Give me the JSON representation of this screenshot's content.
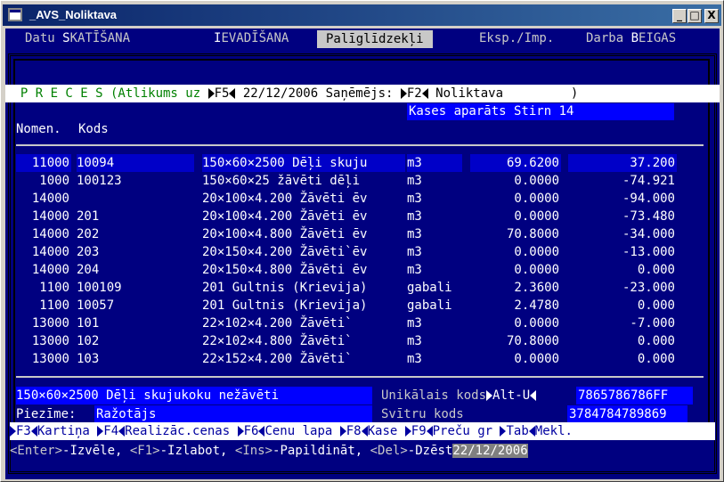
{
  "window": {
    "title": "_AVS_Noliktava",
    "min": "_",
    "max": "□",
    "close": "X"
  },
  "menu": [
    {
      "pre": "Datu ",
      "hot": "S",
      "post": "KATĪŠANA"
    },
    {
      "pre": "",
      "hot": "I",
      "post": "EVADĪŠANA"
    },
    {
      "pre": "Palīglīdzekļi",
      "hot": "",
      "post": ""
    },
    {
      "pre": "Eksp./Imp.",
      "hot": "",
      "post": ""
    },
    {
      "pre": "Darba ",
      "hot": "B",
      "post": "EIGAS"
    }
  ],
  "header": {
    "prefix": "  P R E C E S (Atlikums uz ",
    "f5": "F5",
    "date": " 22/12/2006 Saņēmējs: ",
    "f2": "F2",
    "warehouse": " Noliktava         )"
  },
  "kases": "Kases aparāts Stirn 14",
  "columns": {
    "nomen": "Nomen.",
    "kods": "Kods"
  },
  "rows": [
    {
      "nomen": "11000",
      "kods": "10094",
      "name": "150×60×2500 Dēļi skuju",
      "unit": "m3",
      "qty": "69.6200",
      "price": "37.200"
    },
    {
      "nomen": "1000",
      "kods": "100123",
      "name": "150×60×25 žāvēti dēļi",
      "unit": "m3",
      "qty": "0.0000",
      "price": "-74.921"
    },
    {
      "nomen": "14000",
      "kods": "",
      "name": "20×100×4.200 Žāvēti ēv",
      "unit": "m3",
      "qty": "0.0000",
      "price": "-94.000"
    },
    {
      "nomen": "14000",
      "kods": "201",
      "name": "20×100×4.200 Žāvēti ēv",
      "unit": "m3",
      "qty": "0.0000",
      "price": "-73.480"
    },
    {
      "nomen": "14000",
      "kods": "202",
      "name": "20×100×4.800 Žāvēti ēv",
      "unit": "m3",
      "qty": "70.8000",
      "price": "-34.000"
    },
    {
      "nomen": "14000",
      "kods": "203",
      "name": "20×150×4.200 Žāvēti`ēv",
      "unit": "m3",
      "qty": "0.0000",
      "price": "-13.000"
    },
    {
      "nomen": "14000",
      "kods": "204",
      "name": "20×150×4.800 Žāvēti ēv",
      "unit": "m3",
      "qty": "0.0000",
      "price": "0.000"
    },
    {
      "nomen": "1100",
      "kods": "100109",
      "name": "201 Gultnis (Krievija)",
      "unit": "gabali",
      "qty": "2.3600",
      "price": "-23.000"
    },
    {
      "nomen": "1100",
      "kods": "10057",
      "name": "201 Gultnis (Krievija)",
      "unit": "gabali",
      "qty": "2.4780",
      "price": "0.000"
    },
    {
      "nomen": "13000",
      "kods": "101",
      "name": "22×102×4.200 Žāvēti`",
      "unit": "m3",
      "qty": "0.0000",
      "price": "-7.000"
    },
    {
      "nomen": "13000",
      "kods": "102",
      "name": "22×102×4.800 Žāvēti`",
      "unit": "m3",
      "qty": "70.8000",
      "price": "0.000"
    },
    {
      "nomen": "13000",
      "kods": "103",
      "name": "22×152×4.200 Žāvēti`",
      "unit": "m3",
      "qty": "0.0000",
      "price": "0.000"
    }
  ],
  "details": {
    "full_name": "150×60×2500 Dēļi skujukoku nežāvēti",
    "note_label": "Piezīme: ",
    "note_value": "Ražotājs",
    "unique_label": "Unikālais kods",
    "unique_key": "Alt-U",
    "unique_value": "7865786786FF",
    "barcode_label": "Svītru kods",
    "barcode_value": "3784784789869"
  },
  "fkeys": [
    {
      "key": "F3",
      "label": "Kartiņa "
    },
    {
      "key": "F4",
      "label": "Realizāc.cenas "
    },
    {
      "key": "F6",
      "label": "Cenu lapa "
    },
    {
      "key": "F8",
      "label": "Kase "
    },
    {
      "key": "F9",
      "label": "Preču gr "
    },
    {
      "key": "Tab",
      "label": "Mekl."
    }
  ],
  "status": {
    "enter": "<Enter>",
    "enter_t": "-Izvēle, ",
    "f1": "<F1>",
    "f1_t": "-Izlabot, ",
    "ins": "<Ins>",
    "ins_t": "-Papildināt, ",
    "del": "<Del>",
    "del_t": "-Dzēst",
    "date": "22/12/2006"
  },
  "colors": {
    "bg": "#000080",
    "selected": "#0000c8",
    "highlight": "#0000ff",
    "fkey_text": "#0000a0"
  }
}
